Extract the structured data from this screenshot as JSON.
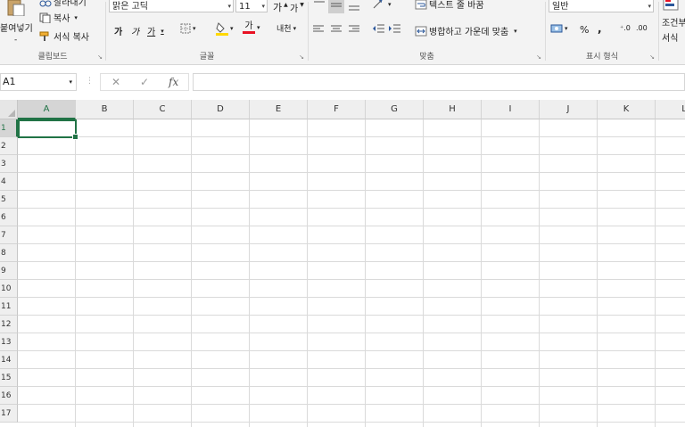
{
  "clipboard": {
    "paste_label_1": "붙여넣기",
    "paste_label_2": "-",
    "cut": "잘라내기",
    "copy": "복사",
    "format_painter": "서식 복사",
    "group_label": "클립보드"
  },
  "font": {
    "name": "맑은 고딕",
    "size": "11",
    "bold": "가",
    "italic": "가",
    "underline": "가",
    "font_color": "가",
    "phonetic": "내천",
    "grow": "가",
    "shrink": "가",
    "group_label": "글꼴"
  },
  "alignment": {
    "wrap_text": "텍스트 줄 바꿈",
    "merge_center": "병합하고 가운데 맞춤",
    "group_label": "맞춤"
  },
  "number": {
    "format": "일반",
    "percent": "%",
    "comma": ",",
    "group_label": "표시 형식"
  },
  "styles": {
    "conditional_1": "조건부",
    "conditional_2": "서식"
  },
  "formula_bar": {
    "name_box": "A1",
    "cancel": "✕",
    "enter": "✓",
    "fx": "fx"
  },
  "sheet": {
    "columns": [
      "A",
      "B",
      "C",
      "D",
      "E",
      "F",
      "G",
      "H",
      "I",
      "J",
      "K",
      "L"
    ],
    "rows": [
      "1",
      "2",
      "3",
      "4",
      "5",
      "6",
      "7",
      "8",
      "9",
      "10",
      "11",
      "12",
      "13",
      "14",
      "15",
      "16",
      "17"
    ],
    "active_cell": "A1"
  },
  "colors": {
    "accent": "#217346",
    "font_color_bar": "#e81123",
    "fill_color_bar": "#ffd800"
  }
}
